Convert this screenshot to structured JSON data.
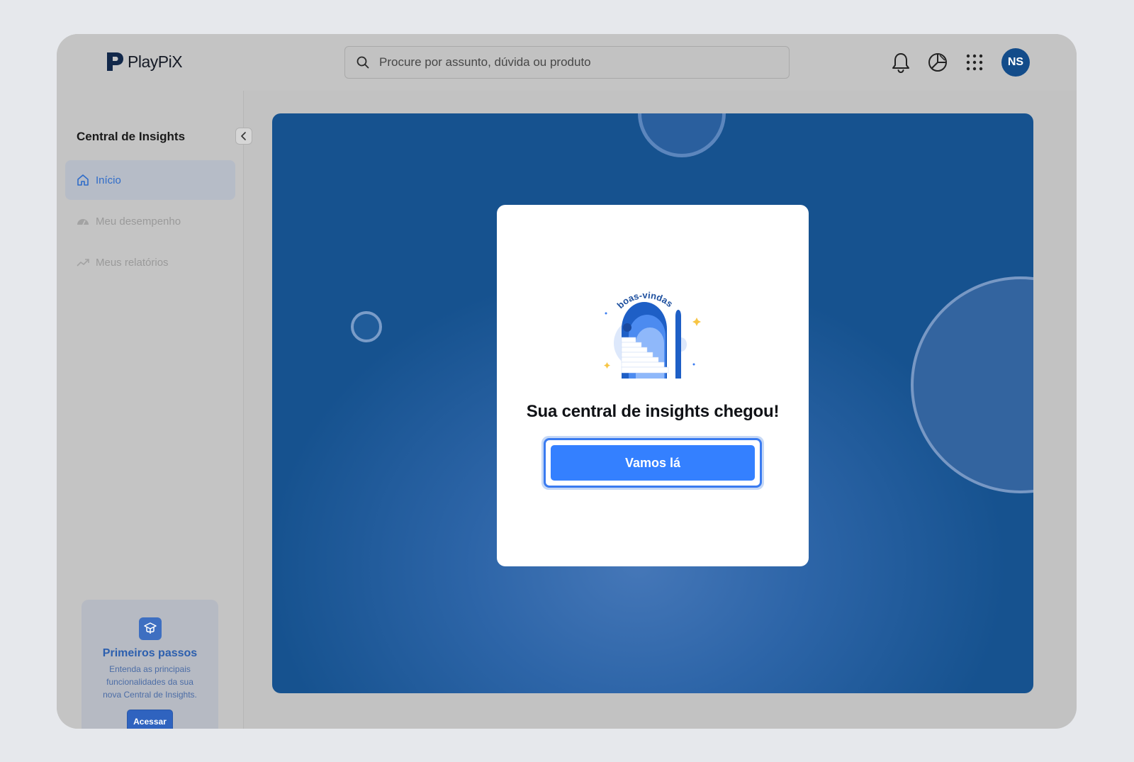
{
  "brand": {
    "name": "PlayPiX"
  },
  "search": {
    "placeholder": "Procure por assunto, dúvida ou produto"
  },
  "header": {
    "icons": [
      "bell-icon",
      "pie-chart-icon",
      "apps-grid-icon"
    ],
    "avatar_initials": "NS"
  },
  "sidebar": {
    "title": "Central de Insights",
    "items": [
      {
        "label": "Início",
        "icon": "home-icon",
        "active": true
      },
      {
        "label": "Meu desempenho",
        "icon": "gauge-icon",
        "active": false
      },
      {
        "label": "Meus relatórios",
        "icon": "trend-up-icon",
        "active": false
      }
    ],
    "card": {
      "icon": "graduation-icon",
      "title": "Primeiros passos",
      "description": "Entenda as principais funcionalidades da sua nova Central de Insights.",
      "button_label": "Acessar"
    }
  },
  "modal": {
    "illustration_text": "boas-vindas",
    "title": "Sua central de insights chegou!",
    "button_label": "Vamos lá"
  },
  "colors": {
    "accent": "#3480ff",
    "banner": "#16528f",
    "avatar": "#134c8a",
    "active_nav": "#2f6cc9"
  }
}
